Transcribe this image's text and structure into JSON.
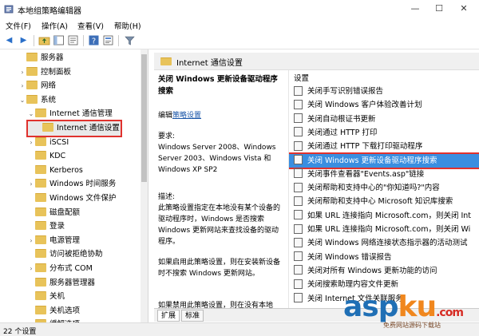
{
  "window": {
    "title": "本地组策略编辑器",
    "min": "—",
    "max": "☐",
    "close": "✕"
  },
  "menu": [
    "文件(F)",
    "操作(A)",
    "查看(V)",
    "帮助(H)"
  ],
  "tree": [
    {
      "label": "服务器",
      "indent": 3,
      "arrow": ""
    },
    {
      "label": "控制面板",
      "indent": 3,
      "arrow": "›"
    },
    {
      "label": "网络",
      "indent": 3,
      "arrow": "›"
    },
    {
      "label": "系统",
      "indent": 3,
      "arrow": "⌄"
    },
    {
      "label": "Internet 通信管理",
      "indent": 4,
      "arrow": "⌄"
    },
    {
      "label": "Internet 通信设置",
      "indent": 5,
      "arrow": "",
      "selected": true
    },
    {
      "label": "iSCSI",
      "indent": 4,
      "arrow": "›"
    },
    {
      "label": "KDC",
      "indent": 4,
      "arrow": ""
    },
    {
      "label": "Kerberos",
      "indent": 4,
      "arrow": ""
    },
    {
      "label": "Windows 时间服务",
      "indent": 4,
      "arrow": "›"
    },
    {
      "label": "Windows 文件保护",
      "indent": 4,
      "arrow": ""
    },
    {
      "label": "磁盘配额",
      "indent": 4,
      "arrow": ""
    },
    {
      "label": "登录",
      "indent": 4,
      "arrow": ""
    },
    {
      "label": "电源管理",
      "indent": 4,
      "arrow": "›"
    },
    {
      "label": "访问被拒绝协助",
      "indent": 4,
      "arrow": ""
    },
    {
      "label": "分布式 COM",
      "indent": 4,
      "arrow": "›"
    },
    {
      "label": "服务器管理器",
      "indent": 4,
      "arrow": ""
    },
    {
      "label": "关机",
      "indent": 4,
      "arrow": ""
    },
    {
      "label": "关机选项",
      "indent": 4,
      "arrow": ""
    },
    {
      "label": "缓解选项",
      "indent": 4,
      "arrow": ""
    }
  ],
  "right_header": "Internet 通信设置",
  "description": {
    "title": "关闭 Windows 更新设备驱动程序搜索",
    "edit_prefix": "编辑",
    "edit_link": "策略设置",
    "req_label": "要求:",
    "req_text": "Windows Server 2008、Windows Server 2003、Windows Vista 和 Windows XP SP2",
    "desc_label": "描述:",
    "desc_text": "此策略设置指定在本地没有某个设备的驱动程序时，Windows 是否搜索 Windows 更新网站来查找设备的驱动程序。",
    "desc_text2": "如果启用此策略设置，则在安装新设备时不搜索 Windows 更新网站。",
    "desc_text3": "如果禁用此策略设置，则在没有本地"
  },
  "list_header": "设置",
  "settings": [
    "关闭手写识别错误报告",
    "关闭 Windows 客户体验改善计划",
    "关闭自动根证书更新",
    "关闭通过 HTTP 打印",
    "关闭通过 HTTP 下载打印驱动程序",
    "关闭 Windows 更新设备驱动程序搜索",
    "关闭事件查看器\"Events.asp\"链接",
    "关闭帮助和支持中心的\"你知道吗?\"内容",
    "关闭帮助和支持中心 Microsoft 知识库搜索",
    "如果 URL 连接指向 Microsoft.com，则关闭 Int",
    "如果 URL 连接指向 Microsoft.com，则关闭 Wi",
    "关闭 Windows 网络连接状态指示器的活动测试",
    "关闭 Windows 错误报告",
    "关闭对所有 Windows 更新功能的访问",
    "关闭搜索助理内容文件更新",
    "关闭 Internet 文件关联服务"
  ],
  "selected_setting_index": 5,
  "tabs": [
    "扩展",
    "标准"
  ],
  "status": "22 个设置",
  "watermark": {
    "brand": "aspku",
    "tld": ".com",
    "sub": "免费网站源码下载站"
  },
  "colors": {
    "folder": "#e8c35a",
    "selection": "#3a8ee0",
    "highlight_box": "#e0322e",
    "wm_blue": "#1f6fb5",
    "wm_orange": "#f0871e",
    "wm_red": "#d62b23"
  }
}
